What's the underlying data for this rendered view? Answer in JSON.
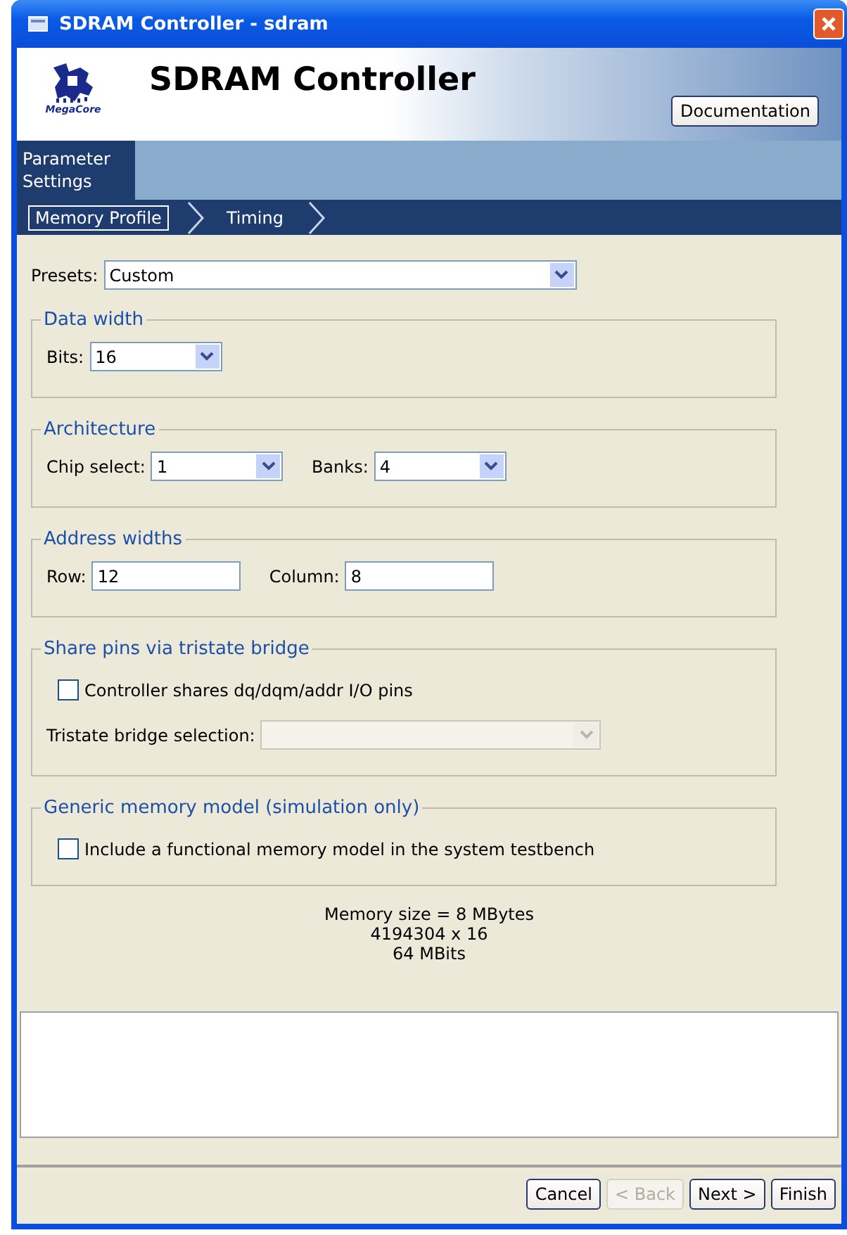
{
  "window": {
    "title": "SDRAM Controller - sdram"
  },
  "header": {
    "logo_text": "MegaCore",
    "title": "SDRAM Controller",
    "documentation_button": "Documentation"
  },
  "tabs": [
    {
      "label": "Parameter Settings",
      "selected": true
    }
  ],
  "steps": [
    {
      "label": "Memory Profile",
      "selected": true
    },
    {
      "label": "Timing",
      "selected": false
    }
  ],
  "presets": {
    "label": "Presets:",
    "value": "Custom"
  },
  "groups": [
    {
      "title": "Data width",
      "fields": [
        {
          "kind": "select",
          "label": "Bits:",
          "value": "16",
          "disabled": false
        }
      ]
    },
    {
      "title": "Architecture",
      "fields": [
        {
          "kind": "select",
          "label": "Chip select:",
          "value": "1",
          "disabled": false
        },
        {
          "kind": "select",
          "label": "Banks:",
          "value": "4",
          "disabled": false
        }
      ]
    },
    {
      "title": "Address widths",
      "fields": [
        {
          "kind": "text",
          "label": "Row:",
          "value": "12"
        },
        {
          "kind": "text",
          "label": "Column:",
          "value": "8"
        }
      ]
    },
    {
      "title": "Share pins via tristate bridge",
      "fields": [
        {
          "kind": "checkbox",
          "label": "Controller shares dq/dqm/addr I/O pins",
          "checked": false
        },
        {
          "kind": "select",
          "label": "Tristate bridge selection:",
          "disabled": true,
          "wide": true
        }
      ]
    },
    {
      "title": "Generic memory model (simulation only)",
      "fields": [
        {
          "kind": "checkbox",
          "label": "Include a functional memory model in the system testbench",
          "checked": false
        }
      ]
    }
  ],
  "summary": [
    "Memory size = 8 MBytes",
    "4194304 x 16",
    "64 MBits"
  ],
  "buttons": [
    {
      "label": "Cancel",
      "disabled": false
    },
    {
      "label": "< Back",
      "disabled": true
    },
    {
      "label": "Next >",
      "disabled": false
    },
    {
      "label": "Finish",
      "disabled": false
    }
  ]
}
